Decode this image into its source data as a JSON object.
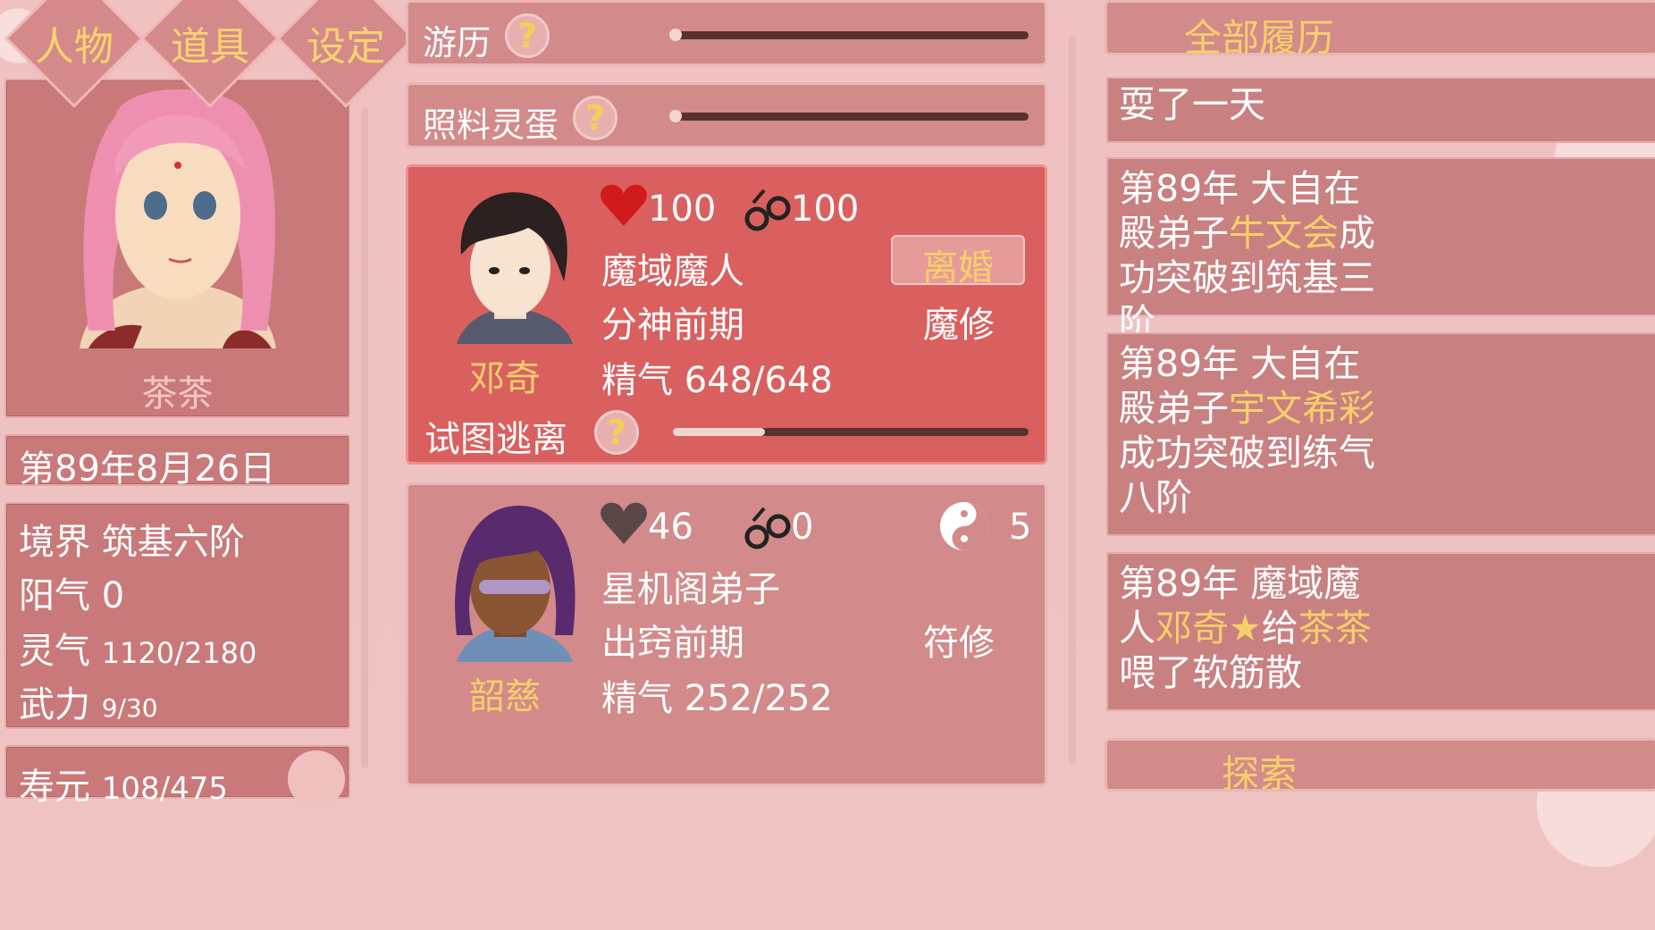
{
  "tabs": [
    "人物",
    "道具",
    "设定"
  ],
  "character": {
    "name": "茶茶",
    "date": "第89年8月26日",
    "stats": [
      {
        "label": "境界",
        "value": "筑基六阶"
      },
      {
        "label": "阳气",
        "value": "0"
      },
      {
        "label": "灵气",
        "value": "1120/2180"
      },
      {
        "label": "武力",
        "value": "9/30"
      }
    ],
    "lifespan_label": "寿元",
    "lifespan_value": "108/475"
  },
  "activities": [
    {
      "label": "游历",
      "help": "?",
      "progress": 0.0
    },
    {
      "label": "照料灵蛋",
      "help": "?",
      "progress": 0.0
    }
  ],
  "companions": [
    {
      "name": "邓奇",
      "affection": "100",
      "bond": "100",
      "title": "魔域魔人",
      "realm": "分神前期",
      "type": "魔修",
      "essence": "精气 648/648",
      "action_button": "离婚",
      "escape_label": "试图逃离",
      "escape_help": "?",
      "escape_progress": 0.26,
      "heart_color": "#d11a1a"
    },
    {
      "name": "韶慈",
      "affection": "46",
      "bond": "0",
      "yinyang": "5",
      "title": "星机阁弟子",
      "realm": "出窍前期",
      "type": "符修",
      "essence": "精气 252/252",
      "heart_color": "#5a4848"
    }
  ],
  "history": {
    "header": "全部履历",
    "entries": [
      {
        "parts": [
          {
            "t": "耍了一天"
          }
        ]
      },
      {
        "parts": [
          {
            "t": "第89年 大自在殿弟子"
          },
          {
            "t": "牛文会",
            "hl": true
          },
          {
            "t": "成功突破到筑基三阶"
          }
        ]
      },
      {
        "parts": [
          {
            "t": "第89年 大自在殿弟子"
          },
          {
            "t": "宇文希彩",
            "hl": true
          },
          {
            "t": "成功突破到练气八阶"
          }
        ]
      },
      {
        "parts": [
          {
            "t": "第89年 魔域魔人"
          },
          {
            "t": "邓奇★",
            "hl": true
          },
          {
            "t": "给"
          },
          {
            "t": "茶茶",
            "hl": true
          },
          {
            "t": "喂了软筋散"
          }
        ]
      }
    ],
    "explore_button": "探索"
  },
  "colors": {
    "accent": "#f6cf6b",
    "panel": "#c9797a",
    "highlight_panel": "#d9605f"
  }
}
